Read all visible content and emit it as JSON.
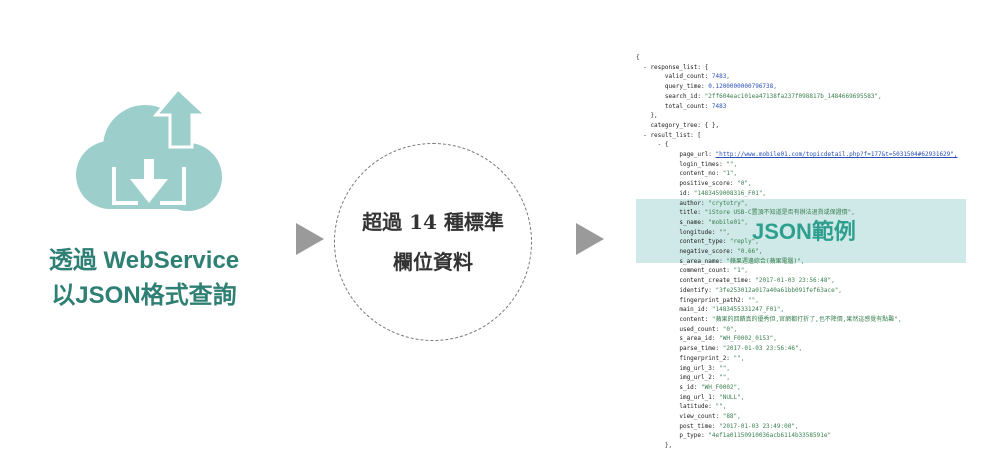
{
  "caption": {
    "line1": "透過 WebService",
    "line2": "以JSON格式查詢"
  },
  "circle": {
    "line1": "超過 14 種標準",
    "line2": "欄位資料"
  },
  "highlight_label": "JSON範例",
  "colors": {
    "accent_teal": "#2e7f74",
    "cloud": "#9ccfcb",
    "highlight": "#a5d7d4",
    "arrow_gray": "#9a9a9a"
  },
  "icons": [
    "cloud-download-upload-icon",
    "right-arrow-icon"
  ],
  "json_lines": [
    "{",
    "  - response_list: {",
    "        valid_count: 7483,",
    "        query_time: 0.1200000000796738,",
    "        search_id: \"2ff604eac101ea47138fa237f098817b_1484669695583\",",
    "        total_count: 7483",
    "    },",
    "    category_tree: { },",
    "  - result_list: [",
    "      - {",
    "            page_url: \"http://www.mobile01.com/topicdetail.php?f=177&t=5031504#62931629\",",
    "            login_times: \"\",",
    "            content_no: \"1\",",
    "            positive_score: \"0\",",
    "            id: \"1483459008316_F01\",",
    "            author: \"crytotry\",",
    "            title: \"iStore USB-C置頂不知道是否有辦法退貨或保證價\",",
    "            s_name: \"mobile01\",",
    "            longitude: \"\",",
    "            content_type: \"reply\",",
    "            negative_score: \"0.66\",",
    "            s_area_name: \"蘋果週邊綜合(蘋果電腦)\",",
    "            comment_count: \"1\",",
    "            content_create_time: \"2017-01-03 23:56:48\",",
    "            identify: \"3fe253012a017a40a61bb091fef63ace\",",
    "            fingerprint_path2: \"\",",
    "            main_id: \"1483455331247_F01\",",
    "            content: \"蘋果的回饋真的優秀但,官網都打折了,也不降價,果然這感覺有點難\",",
    "            used_count: \"0\",",
    "            s_area_id: \"WH_F0002_0153\",",
    "            parse_time: \"2017-01-03 23:56:46\",",
    "            fingerprint_2: \"\",",
    "            img_url_3: \"\",",
    "            img_url_2: \"\",",
    "            s_id: \"WH_F0002\",",
    "            img_url_1: \"NULL\",",
    "            latitude: \"\",",
    "            view_count: \"88\",",
    "            post_time: \"2017-01-03 23:49:00\",",
    "            p_type: \"4ef1a01150910036acb6114b3358591e\"",
    "        },"
  ]
}
